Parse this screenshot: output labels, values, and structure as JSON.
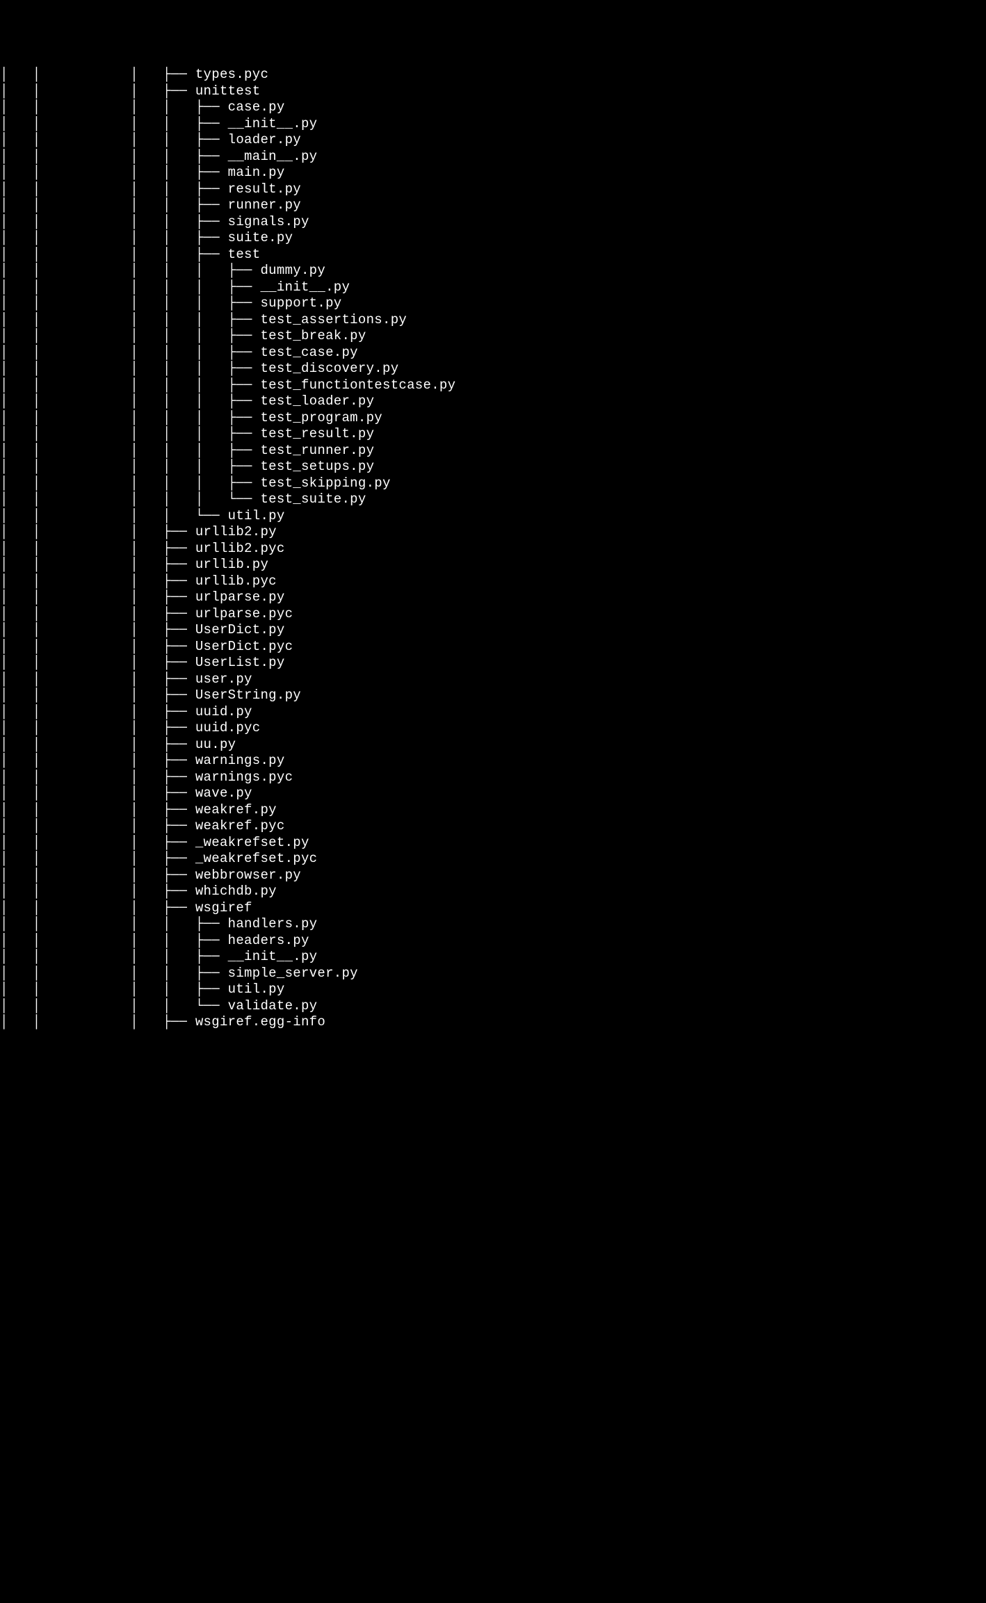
{
  "tree": {
    "ancestor_pipes": [
      true,
      true,
      false,
      false,
      true
    ],
    "nodes": [
      {
        "depth": 0,
        "branch": "tee",
        "label": "types.pyc"
      },
      {
        "depth": 0,
        "branch": "tee",
        "label": "unittest",
        "children": [
          {
            "depth": 1,
            "branch": "tee",
            "label": "case.py"
          },
          {
            "depth": 1,
            "branch": "tee",
            "label": "__init__.py"
          },
          {
            "depth": 1,
            "branch": "tee",
            "label": "loader.py"
          },
          {
            "depth": 1,
            "branch": "tee",
            "label": "__main__.py"
          },
          {
            "depth": 1,
            "branch": "tee",
            "label": "main.py"
          },
          {
            "depth": 1,
            "branch": "tee",
            "label": "result.py"
          },
          {
            "depth": 1,
            "branch": "tee",
            "label": "runner.py"
          },
          {
            "depth": 1,
            "branch": "tee",
            "label": "signals.py"
          },
          {
            "depth": 1,
            "branch": "tee",
            "label": "suite.py"
          },
          {
            "depth": 1,
            "branch": "tee",
            "label": "test",
            "children": [
              {
                "depth": 2,
                "branch": "tee",
                "label": "dummy.py"
              },
              {
                "depth": 2,
                "branch": "tee",
                "label": "__init__.py"
              },
              {
                "depth": 2,
                "branch": "tee",
                "label": "support.py"
              },
              {
                "depth": 2,
                "branch": "tee",
                "label": "test_assertions.py"
              },
              {
                "depth": 2,
                "branch": "tee",
                "label": "test_break.py"
              },
              {
                "depth": 2,
                "branch": "tee",
                "label": "test_case.py"
              },
              {
                "depth": 2,
                "branch": "tee",
                "label": "test_discovery.py"
              },
              {
                "depth": 2,
                "branch": "tee",
                "label": "test_functiontestcase.py"
              },
              {
                "depth": 2,
                "branch": "tee",
                "label": "test_loader.py"
              },
              {
                "depth": 2,
                "branch": "tee",
                "label": "test_program.py"
              },
              {
                "depth": 2,
                "branch": "tee",
                "label": "test_result.py"
              },
              {
                "depth": 2,
                "branch": "tee",
                "label": "test_runner.py"
              },
              {
                "depth": 2,
                "branch": "tee",
                "label": "test_setups.py"
              },
              {
                "depth": 2,
                "branch": "tee",
                "label": "test_skipping.py"
              },
              {
                "depth": 2,
                "branch": "end",
                "label": "test_suite.py"
              }
            ]
          },
          {
            "depth": 1,
            "branch": "end",
            "label": "util.py"
          }
        ]
      },
      {
        "depth": 0,
        "branch": "tee",
        "label": "urllib2.py"
      },
      {
        "depth": 0,
        "branch": "tee",
        "label": "urllib2.pyc"
      },
      {
        "depth": 0,
        "branch": "tee",
        "label": "urllib.py"
      },
      {
        "depth": 0,
        "branch": "tee",
        "label": "urllib.pyc"
      },
      {
        "depth": 0,
        "branch": "tee",
        "label": "urlparse.py"
      },
      {
        "depth": 0,
        "branch": "tee",
        "label": "urlparse.pyc"
      },
      {
        "depth": 0,
        "branch": "tee",
        "label": "UserDict.py"
      },
      {
        "depth": 0,
        "branch": "tee",
        "label": "UserDict.pyc"
      },
      {
        "depth": 0,
        "branch": "tee",
        "label": "UserList.py"
      },
      {
        "depth": 0,
        "branch": "tee",
        "label": "user.py"
      },
      {
        "depth": 0,
        "branch": "tee",
        "label": "UserString.py"
      },
      {
        "depth": 0,
        "branch": "tee",
        "label": "uuid.py"
      },
      {
        "depth": 0,
        "branch": "tee",
        "label": "uuid.pyc"
      },
      {
        "depth": 0,
        "branch": "tee",
        "label": "uu.py"
      },
      {
        "depth": 0,
        "branch": "tee",
        "label": "warnings.py"
      },
      {
        "depth": 0,
        "branch": "tee",
        "label": "warnings.pyc"
      },
      {
        "depth": 0,
        "branch": "tee",
        "label": "wave.py"
      },
      {
        "depth": 0,
        "branch": "tee",
        "label": "weakref.py"
      },
      {
        "depth": 0,
        "branch": "tee",
        "label": "weakref.pyc"
      },
      {
        "depth": 0,
        "branch": "tee",
        "label": "_weakrefset.py"
      },
      {
        "depth": 0,
        "branch": "tee",
        "label": "_weakrefset.pyc"
      },
      {
        "depth": 0,
        "branch": "tee",
        "label": "webbrowser.py"
      },
      {
        "depth": 0,
        "branch": "tee",
        "label": "whichdb.py"
      },
      {
        "depth": 0,
        "branch": "tee",
        "label": "wsgiref",
        "children": [
          {
            "depth": 1,
            "branch": "tee",
            "label": "handlers.py"
          },
          {
            "depth": 1,
            "branch": "tee",
            "label": "headers.py"
          },
          {
            "depth": 1,
            "branch": "tee",
            "label": "__init__.py"
          },
          {
            "depth": 1,
            "branch": "tee",
            "label": "simple_server.py"
          },
          {
            "depth": 1,
            "branch": "tee",
            "label": "util.py"
          },
          {
            "depth": 1,
            "branch": "end",
            "label": "validate.py"
          }
        ]
      },
      {
        "depth": 0,
        "branch": "tee",
        "label": "wsgiref.egg-info"
      }
    ],
    "glyphs": {
      "pipe": "│   ",
      "blank": " ",
      "tee": "├── ",
      "end": "└── "
    }
  }
}
